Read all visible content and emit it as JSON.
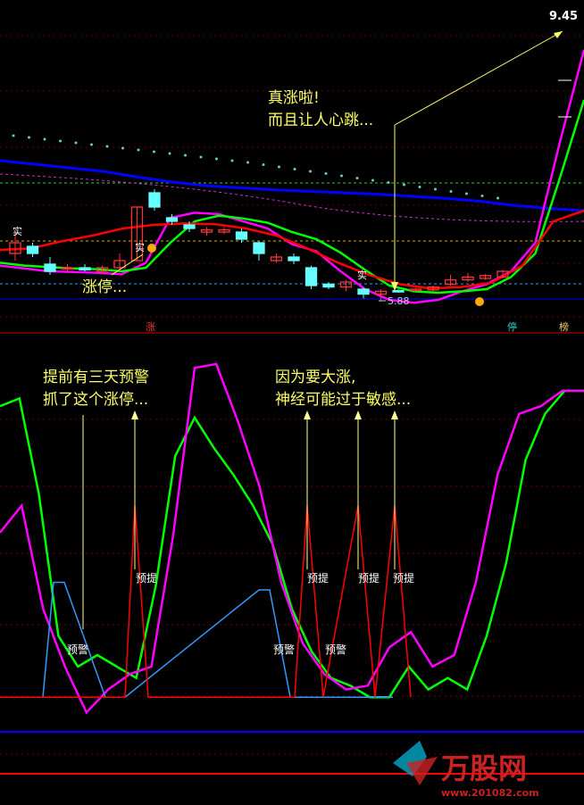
{
  "chart_data": [
    {
      "type": "candlestick",
      "price_labels": {
        "high": "9.45",
        "low": "5.88"
      },
      "candles": [
        {
          "o": 6.55,
          "c": 6.7,
          "h": 6.85,
          "l": 6.45,
          "up": true
        },
        {
          "o": 6.65,
          "c": 6.55,
          "h": 6.7,
          "l": 6.5,
          "up": false
        },
        {
          "o": 6.4,
          "c": 6.3,
          "h": 6.5,
          "l": 6.25,
          "up": false
        },
        {
          "o": 6.35,
          "c": 6.35,
          "h": 6.4,
          "l": 6.3,
          "up": true
        },
        {
          "o": 6.35,
          "c": 6.32,
          "h": 6.4,
          "l": 6.3,
          "up": false
        },
        {
          "o": 6.3,
          "c": 6.35,
          "h": 6.38,
          "l": 6.27,
          "up": true
        },
        {
          "o": 6.35,
          "c": 6.45,
          "h": 6.55,
          "l": 6.3,
          "up": true
        },
        {
          "o": 6.45,
          "c": 7.2,
          "h": 7.2,
          "l": 6.45,
          "up": true
        },
        {
          "o": 7.4,
          "c": 7.2,
          "h": 7.45,
          "l": 7.15,
          "up": false
        },
        {
          "o": 7.05,
          "c": 7.0,
          "h": 7.1,
          "l": 6.95,
          "up": false
        },
        {
          "o": 6.95,
          "c": 6.9,
          "h": 7.0,
          "l": 6.85,
          "up": false
        },
        {
          "o": 6.85,
          "c": 6.88,
          "h": 6.92,
          "l": 6.8,
          "up": true
        },
        {
          "o": 6.88,
          "c": 6.85,
          "h": 6.92,
          "l": 6.82,
          "up": true
        },
        {
          "o": 6.85,
          "c": 6.75,
          "h": 6.9,
          "l": 6.7,
          "up": false
        },
        {
          "o": 6.7,
          "c": 6.55,
          "h": 6.72,
          "l": 6.45,
          "up": false
        },
        {
          "o": 6.45,
          "c": 6.5,
          "h": 6.55,
          "l": 6.42,
          "up": true
        },
        {
          "o": 6.5,
          "c": 6.45,
          "h": 6.55,
          "l": 6.4,
          "up": false
        },
        {
          "o": 6.35,
          "c": 6.1,
          "h": 6.38,
          "l": 6.05,
          "up": false
        },
        {
          "o": 6.12,
          "c": 6.08,
          "h": 6.15,
          "l": 6.05,
          "up": false
        },
        {
          "o": 6.15,
          "c": 6.08,
          "h": 6.18,
          "l": 6.02,
          "up": true
        },
        {
          "o": 6.05,
          "c": 5.98,
          "h": 6.07,
          "l": 5.92,
          "up": false
        },
        {
          "o": 5.98,
          "c": 6.02,
          "h": 6.05,
          "l": 5.88,
          "up": true
        },
        {
          "o": 6.02,
          "c": 6.03,
          "h": 6.05,
          "l": 6.0,
          "up": false
        },
        {
          "o": 6.05,
          "c": 6.04,
          "h": 6.07,
          "l": 6.02,
          "up": true
        },
        {
          "o": 6.04,
          "c": 6.08,
          "h": 6.1,
          "l": 6.02,
          "up": true
        },
        {
          "o": 6.12,
          "c": 6.18,
          "h": 6.25,
          "l": 6.1,
          "up": true
        },
        {
          "o": 6.18,
          "c": 6.22,
          "h": 6.28,
          "l": 6.15,
          "up": true
        },
        {
          "o": 6.2,
          "c": 6.24,
          "h": 6.26,
          "l": 6.18,
          "up": true
        },
        {
          "o": 6.22,
          "c": 6.3,
          "h": 6.32,
          "l": 6.2,
          "up": true
        }
      ],
      "series": [
        {
          "color": "#0000ff",
          "values": [
            7.85,
            7.8,
            7.75,
            7.7,
            7.62,
            7.55,
            7.5,
            7.47,
            7.44,
            7.42,
            7.4,
            7.38,
            7.35,
            7.32,
            7.28,
            7.22,
            7.18,
            7.15
          ]
        },
        {
          "color": "#ff00ff",
          "values": [
            6.38,
            6.34,
            6.3,
            6.29,
            6.28,
            6.26,
            6.42,
            7.05,
            7.12,
            7.1,
            7.0,
            6.9,
            6.68,
            6.58,
            6.3,
            6.05,
            5.9,
            5.86,
            5.9,
            6.02,
            6.12,
            6.3,
            6.7,
            8.1,
            9.4
          ]
        },
        {
          "color": "#00ff00",
          "values": [
            6.42,
            6.38,
            6.36,
            6.34,
            6.33,
            6.3,
            6.35,
            6.7,
            7.0,
            7.08,
            7.04,
            6.98,
            6.85,
            6.75,
            6.56,
            6.32,
            6.1,
            6.02,
            6.0,
            6.02,
            6.05,
            6.22,
            6.55,
            7.6,
            8.7
          ]
        },
        {
          "color": "#ff0000",
          "values": [
            6.6,
            6.62,
            6.72,
            6.8,
            6.9,
            6.95,
            6.97,
            6.96,
            6.9,
            6.8,
            6.62,
            6.42,
            6.25,
            6.12,
            6.06,
            6.08,
            6.14,
            6.38,
            7.0,
            7.15
          ]
        }
      ],
      "annotations": [
        {
          "text": "真涨啦!"
        },
        {
          "text": "而且让人心跳..."
        },
        {
          "text": "涨停..."
        },
        {
          "text": "实"
        },
        {
          "text": "实"
        },
        {
          "text": "实"
        }
      ],
      "markers": [
        {
          "text": "涨",
          "color": "#ff3333"
        },
        {
          "text": "停",
          "color": "#33cccc"
        },
        {
          "text": "榜",
          "color": "#ffcc66"
        }
      ]
    },
    {
      "type": "line",
      "series": [
        {
          "color": "#00ff00",
          "values": [
            0.96,
            0.98,
            0.73,
            0.36,
            0.28,
            0.31,
            0.28,
            0.25,
            0.49,
            0.83,
            0.93,
            0.85,
            0.78,
            0.7,
            0.6,
            0.43,
            0.32,
            0.25,
            0.23,
            0.2,
            0.2,
            0.28,
            0.22,
            0.25,
            0.22,
            0.36,
            0.55,
            0.82,
            0.94,
            1.0,
            1.0
          ]
        },
        {
          "color": "#ff00ff",
          "values": [
            0.63,
            0.7,
            0.43,
            0.28,
            0.16,
            0.22,
            0.26,
            0.28,
            0.62,
            1.06,
            1.07,
            0.92,
            0.75,
            0.5,
            0.34,
            0.26,
            0.22,
            0.23,
            0.33,
            0.37,
            0.28,
            0.31,
            0.5,
            0.78,
            0.94,
            0.96,
            1.0,
            1.0
          ]
        },
        {
          "color": "#3399ff",
          "values": [
            0.2,
            0.5,
            0.5,
            0.2,
            0.2,
            0.48,
            0.48,
            0.2,
            0.2,
            0.2
          ]
        },
        {
          "color": "#ff0000",
          "values": [
            0.2,
            0.2,
            0.2,
            0.2,
            0.7,
            0.2,
            0.2,
            0.7,
            0.2,
            0.7,
            0.2,
            0.7,
            0.2
          ]
        }
      ],
      "annotations": [
        {
          "text": "提前有三天预警"
        },
        {
          "text": "抓了这个涨停..."
        },
        {
          "text": "因为要大涨,"
        },
        {
          "text": "神经可能过于敏感..."
        },
        {
          "text": "预警"
        },
        {
          "text": "预提"
        },
        {
          "text": "预警"
        },
        {
          "text": "预警"
        },
        {
          "text": "预提"
        },
        {
          "text": "预提"
        },
        {
          "text": "预提"
        }
      ]
    }
  ],
  "watermark": {
    "brand": "万股网",
    "url": "www.201082.com"
  }
}
